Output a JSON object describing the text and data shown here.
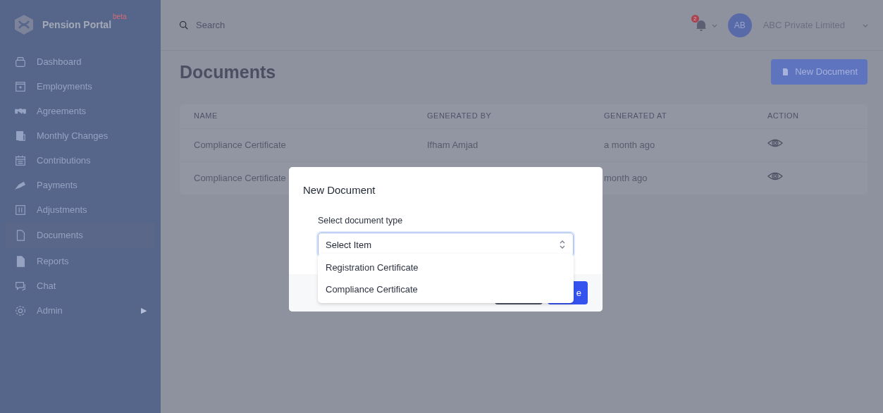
{
  "sidebar": {
    "brand": "Pension Portal",
    "brand_badge": "beta",
    "items": [
      {
        "label": "Dashboard",
        "selected": false
      },
      {
        "label": "Employments",
        "selected": false
      },
      {
        "label": "Agreements",
        "selected": false
      },
      {
        "label": "Monthly Changes",
        "selected": false
      },
      {
        "label": "Contributions",
        "selected": false
      },
      {
        "label": "Payments",
        "selected": false
      },
      {
        "label": "Adjustments",
        "selected": false
      },
      {
        "label": "Documents",
        "selected": true
      },
      {
        "label": "Reports",
        "selected": false
      },
      {
        "label": "Chat",
        "selected": false
      },
      {
        "label": "Admin",
        "selected": false,
        "submenu_arrow": "▶"
      }
    ]
  },
  "topbar": {
    "search": {
      "placeholder": "Search"
    },
    "notification_count": "2",
    "avatar_initials": "AB",
    "company": "ABC Private Limited"
  },
  "page": {
    "title": "Documents",
    "new_button": "New Document"
  },
  "table": {
    "columns": [
      "NAME",
      "GENERATED BY",
      "GENERATED AT",
      "ACTION"
    ],
    "rows": [
      {
        "name": "Compliance Certificate",
        "generated_by": "Ifham Amjad",
        "generated_at": "a month ago"
      },
      {
        "name": "Compliance Certificate",
        "generated_by": "",
        "generated_at": "month ago"
      }
    ]
  },
  "modal": {
    "title": "New Document",
    "field_label": "Select document type",
    "select_value": "Select Item",
    "options": [
      "Registration Certificate",
      "Compliance Certificate"
    ],
    "save_button_visible_text": "e"
  }
}
